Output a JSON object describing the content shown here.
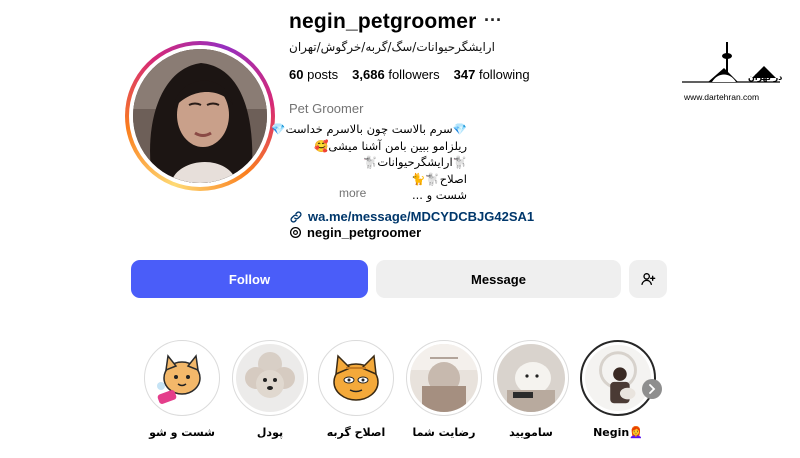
{
  "profile": {
    "username": "negin_petgroomer",
    "more_icon": "ellipsis-icon",
    "fullname": "ارایشگرحیوانات/سگ/گربه/خرگوش/تهران",
    "stats": {
      "posts_count": "60",
      "posts_label": "posts",
      "followers_count": "3,686",
      "followers_label": "followers",
      "following_count": "347",
      "following_label": "following"
    },
    "category": "Pet Groomer",
    "bio_lines": [
      "💎سرم بالاست چون بالاسرم خداست💎",
      "ریلزامو ببین بامن آشنا میشی🥰",
      "🐩ارایشگرحیوانات🐩",
      "اصلاح🐩🐈",
      "شست و ..."
    ],
    "more_label": "more",
    "link": "wa.me/message/MDCYDCBJG42SA1",
    "threads_handle": "negin_petgroomer"
  },
  "actions": {
    "follow_label": "Follow",
    "message_label": "Message",
    "add_user_icon": "add-user-icon"
  },
  "highlights": [
    {
      "label": "شست و شو"
    },
    {
      "label": "پودل"
    },
    {
      "label": "اصلاح گربه"
    },
    {
      "label": "رضایت شما"
    },
    {
      "label": "سامویید"
    },
    {
      "label": "Negin👩‍🦰"
    }
  ],
  "watermark": {
    "brand": "در تهران",
    "url": "www.dartehran.com"
  },
  "colors": {
    "follow_button": "#4a5df9",
    "secondary_button": "#efefef",
    "link": "#00376b",
    "muted": "#737373"
  }
}
